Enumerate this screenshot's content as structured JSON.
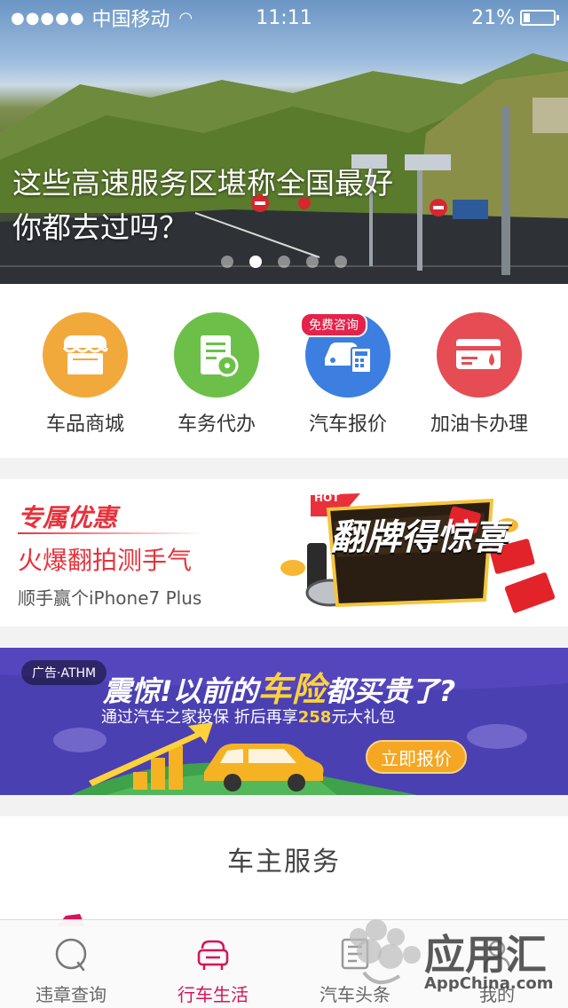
{
  "status_bar": {
    "carrier": "中国移动",
    "time": "11:11",
    "battery": "21%",
    "battery_level": 0.21
  },
  "hero": {
    "title": "这些高速服务区堪称全国最好\n你都去过吗？",
    "page_count": 5,
    "active_page": 2
  },
  "quick_services": [
    {
      "label": "车品商城",
      "icon": "shop-icon",
      "color": "#f2a93b"
    },
    {
      "label": "车务代办",
      "icon": "document-icon",
      "color": "#6cc04a"
    },
    {
      "label": "汽车报价",
      "icon": "car-calculator-icon",
      "color": "#3c7fe0",
      "badge": "免费咨询"
    },
    {
      "label": "加油卡办理",
      "icon": "fuel-card-icon",
      "color": "#e64c53"
    }
  ],
  "promo": {
    "tag": "专属优惠",
    "title": "火爆翻拍测手气",
    "subtitle": "顺手赢个iPhone7 Plus",
    "art_title": "翻牌得惊喜",
    "art_ribbon": "HOT"
  },
  "ad": {
    "tag": "广告·ATHM",
    "headline_before": "震惊!以前的",
    "headline_highlight": "车险",
    "headline_after": "都买贵了?",
    "sub_before": "通过汽车之家投保  折后再享",
    "sub_highlight": "258",
    "sub_after": "元大礼包",
    "button": "立即报价"
  },
  "owner_services": {
    "title": "车主服务"
  },
  "tab_bar": {
    "tabs": [
      {
        "label": "违章查询",
        "icon": "search-icon"
      },
      {
        "label": "行车生活",
        "icon": "car-life-icon",
        "active": true
      },
      {
        "label": "汽车头条",
        "icon": "news-icon"
      },
      {
        "label": "我的",
        "icon": "profile-icon"
      }
    ]
  },
  "watermark": {
    "text": "应用汇",
    "sub": "AppChina.com"
  },
  "colors": {
    "accent": "#d4145a",
    "promo_red": "#e8313b",
    "ad_bg": "#4a3fb0",
    "ad_yellow": "#ffd23a"
  }
}
